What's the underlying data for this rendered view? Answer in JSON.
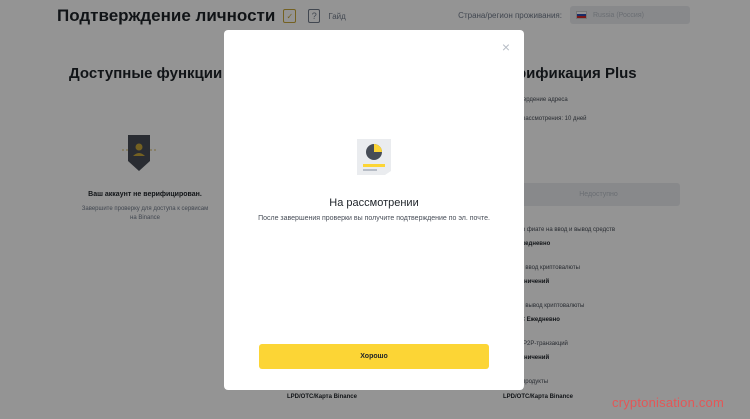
{
  "header": {
    "title": "Подтверждение личности",
    "guide_label": "Гайд",
    "country_label": "Страна/регион проживания:",
    "country_value": "Russia (Россия)"
  },
  "features": {
    "title": "Доступные функции",
    "unverified_title": "Ваш аккаунт не верифицирован.",
    "unverified_desc": "Завершите проверку для доступа к сервисам на Binance"
  },
  "plus": {
    "title": "рификация Plus",
    "line1": "твердение адреса",
    "line2": "о рассмотрения: 10 дней",
    "unavailable_label": "Недоступно",
    "fiat_label": "и в фиате на ввод и вывод средств",
    "fiat_value": "Ежедневно",
    "crypto_in_label": "на ввод криптовалюты",
    "crypto_in_value": "раничений",
    "crypto_out_label": "на вывод криптовалюты",
    "crypto_out_value": "ТС Ежедневно",
    "p2p_label": "ы P2P-транзакций",
    "p2p_value": "раничений",
    "products_label": "е продукты"
  },
  "bottom": {
    "left": "LPD/OTC/Карта Binance",
    "right": "LPD/OTC/Карта Binance"
  },
  "watermark": "cryptonisation.com",
  "modal": {
    "close_symbol": "×",
    "title": "На рассмотрении",
    "description": "После завершения проверки вы получите подтверждение по эл. почте.",
    "ok_label": "Хорошо"
  },
  "colors": {
    "accent": "#fcd535",
    "shield_dark": "#474d57",
    "watermark": "#e35757"
  }
}
